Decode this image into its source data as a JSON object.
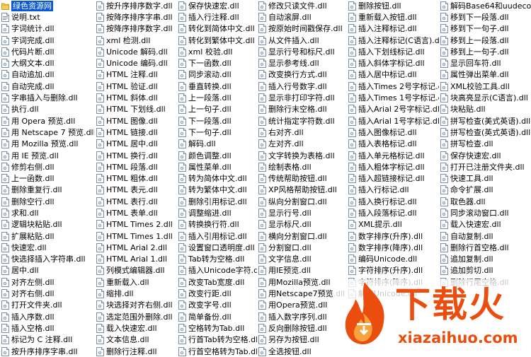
{
  "colors": {
    "selection": "#0a58d6",
    "watermark": "#ea4d0e"
  },
  "icons": {
    "folder": "folder-icon",
    "text_file": "text-file-icon",
    "dll_file": "dll-file-icon"
  },
  "columns": [
    [
      {
        "name": "绿色资源网",
        "icon": "folder",
        "selected": true
      },
      {
        "name": "说明.txt",
        "icon": "txt"
      },
      {
        "name": "字词统计.dll"
      },
      {
        "name": "字词完成.dll"
      },
      {
        "name": "代码片断.dll"
      },
      {
        "name": "大纲文本.dll"
      },
      {
        "name": "自动追加.dll"
      },
      {
        "name": "自动完成.dll"
      },
      {
        "name": "字串插入与删除.dll"
      },
      {
        "name": "执行.dll"
      },
      {
        "name": "用 Opera 预览.dll"
      },
      {
        "name": "用 Netscape 7 预览.dll"
      },
      {
        "name": "用 Mozilla 预览.dll"
      },
      {
        "name": "用 IE 预览.dll"
      },
      {
        "name": "修剪右侧.dll"
      },
      {
        "name": "上一函数.dll"
      },
      {
        "name": "删除重复行.dll"
      },
      {
        "name": "删除空行.dll"
      },
      {
        "name": "求和.dll"
      },
      {
        "name": "逻辑块粘贴.dll"
      },
      {
        "name": "扩展粘贴.dll"
      },
      {
        "name": "快速宏.dll"
      },
      {
        "name": "快选择插入字符串.dll"
      },
      {
        "name": "居中.dll"
      },
      {
        "name": "对齐左侧.dll"
      },
      {
        "name": "对齐右侧.dll"
      },
      {
        "name": "打开文件夹.dll"
      },
      {
        "name": "插入序数.dll"
      },
      {
        "name": "插入空格.dll"
      },
      {
        "name": "标记为 C 注释.dll"
      },
      {
        "name": "按升序排序字串.dll"
      }
    ],
    [
      {
        "name": "按升序排序数字.dll"
      },
      {
        "name": "按降序排序字串.dll"
      },
      {
        "name": "按降序排序数字.dll"
      },
      {
        "name": "xml 检测.dll"
      },
      {
        "name": "Unicode 解码.dll"
      },
      {
        "name": "Unicode 编码.dll"
      },
      {
        "name": "HTML 注释.dll"
      },
      {
        "name": "HTML 验证.dll"
      },
      {
        "name": "HTML 斜体.dll"
      },
      {
        "name": "HTML 下划线.dll"
      },
      {
        "name": "HTML 图像.dll"
      },
      {
        "name": "HTML 链接.dll"
      },
      {
        "name": "HTML 居中.dll"
      },
      {
        "name": "HTML 换行.dll"
      },
      {
        "name": "HTML 段落.dll"
      },
      {
        "name": "HTML 粗体.dll"
      },
      {
        "name": "HTML 表元.dll"
      },
      {
        "name": "HTML 表行.dll"
      },
      {
        "name": "HTML 表单.dll"
      },
      {
        "name": "HTML Times 2.dll"
      },
      {
        "name": "HTML Times 1.dll"
      },
      {
        "name": "HTML Arial 2.dll"
      },
      {
        "name": "HTML Arial 1.dll"
      },
      {
        "name": "列模式编辑器.dll"
      },
      {
        "name": "重新载入.dll"
      },
      {
        "name": "缩排.dll"
      },
      {
        "name": "块选择对齐右侧.dll"
      },
      {
        "name": "选定范围外删除.dll"
      },
      {
        "name": "载入快速宏.dll"
      },
      {
        "name": "文本信息.dll"
      },
      {
        "name": "删除行注释.dll"
      }
    ],
    [
      {
        "name": "保存快速宏.dll"
      },
      {
        "name": "插入行注释.dll"
      },
      {
        "name": "转化到简体中文.dll"
      },
      {
        "name": "转化到繁体中文.dll"
      },
      {
        "name": "xml 校验.dll"
      },
      {
        "name": "下一函数.dll"
      },
      {
        "name": "同步滚动.dll"
      },
      {
        "name": "垂直转换.dll"
      },
      {
        "name": "上一段落.dll"
      },
      {
        "name": "上一句子.dll"
      },
      {
        "name": "下一段落.dll"
      },
      {
        "name": "下一句子.dll"
      },
      {
        "name": "解码.dll"
      },
      {
        "name": "颜色调整.dll"
      },
      {
        "name": "属性菜单.dll"
      },
      {
        "name": "转为简体中文.dll"
      },
      {
        "name": "转为繁体中文.dll"
      },
      {
        "name": "删除引用标记.dll"
      },
      {
        "name": "调整缩进.dll"
      },
      {
        "name": "转换换行符.dll"
      },
      {
        "name": "插入引用标记.dll"
      },
      {
        "name": "设置窗口透明度.dll"
      },
      {
        "name": "Tab转为空格.dll"
      },
      {
        "name": "插入Unicode字符.dll"
      },
      {
        "name": "改变Tab宽度.dll"
      },
      {
        "name": "改变行距.dll"
      },
      {
        "name": "改变字号.dll"
      },
      {
        "name": "简单备份.dll"
      },
      {
        "name": "空格转为Tab.dll"
      },
      {
        "name": "行首Tab转为空格.dll"
      },
      {
        "name": "行首空格转为Tab.dll"
      }
    ],
    [
      {
        "name": "修改只读文件.dll"
      },
      {
        "name": "自动滚屏.dll"
      },
      {
        "name": "按原始时间戳保存.dll"
      },
      {
        "name": "从文件插入.dll"
      },
      {
        "name": "显示行号和标尺.dll"
      },
      {
        "name": "显示参考线.dll"
      },
      {
        "name": "改变换行方式.dll"
      },
      {
        "name": "插入行号数字.dll"
      },
      {
        "name": "显示非打印字符.dll"
      },
      {
        "name": "删除行末空格.dll"
      },
      {
        "name": "统计指定字符数.dll"
      },
      {
        "name": "右对齐.dll"
      },
      {
        "name": "左对齐.dll"
      },
      {
        "name": "文字转换为表格.dll"
      },
      {
        "name": "绘制表格.dll"
      },
      {
        "name": "传统帮助按钮.dll"
      },
      {
        "name": "XP风格帮助按钮.dll"
      },
      {
        "name": "纵向分割窗口.dll"
      },
      {
        "name": "显示行号.dll"
      },
      {
        "name": "显示标尺.dll"
      },
      {
        "name": "横向分割窗口.dll"
      },
      {
        "name": "分割窗口.dll"
      },
      {
        "name": "文字信息.dll"
      },
      {
        "name": "用IE预览.dll"
      },
      {
        "name": "用Mozilla预览.dll"
      },
      {
        "name": "用Netscape7预览.dll"
      },
      {
        "name": "用Opera预览.dll"
      },
      {
        "name": "插入数字序列.dll"
      },
      {
        "name": "反向删除按钮.dll"
      },
      {
        "name": "另存为按钮.dll"
      },
      {
        "name": "全选按钮.dll"
      }
    ],
    [
      {
        "name": "删除按钮.dll"
      },
      {
        "name": "重新载入按钮.dll"
      },
      {
        "name": "插入注释标记.dll"
      },
      {
        "name": "插入注释标记(C语言).dll"
      },
      {
        "name": "插入下划线标记.dll"
      },
      {
        "name": "插入斜体字标记.dll"
      },
      {
        "name": "插入居中标记.dll"
      },
      {
        "name": "插入Times 2号字标记.dll"
      },
      {
        "name": "插入Times 1号字标记.dll"
      },
      {
        "name": "插入Arial 2号字标记.dll"
      },
      {
        "name": "插入Arial 1号字标记.dll"
      },
      {
        "name": "插入图像标记.dll"
      },
      {
        "name": "插入表格标记.dll"
      },
      {
        "name": "插入单元格标记.dll"
      },
      {
        "name": "插入粗体字标记.dll"
      },
      {
        "name": "插入超链接标记.dll"
      },
      {
        "name": "插入行标记.dll"
      },
      {
        "name": "插入换行标记.dll"
      },
      {
        "name": "插入段落标记.dll"
      },
      {
        "name": "XML提示.dll"
      },
      {
        "name": "数字排序(升序).dll"
      },
      {
        "name": "数字排序(降序).dll"
      },
      {
        "name": "编码Unicode.dll"
      },
      {
        "name": "字符排序(升序).dll"
      },
      {
        "name": "字符排序(降序).dll"
      },
      {
        "name": "解码Unicode.dll"
      },
      {
        "name": "",
        "hidden": true
      },
      {
        "name": "",
        "hidden": true
      },
      {
        "name": "",
        "hidden": true
      },
      {
        "name": "",
        "hidden": true
      },
      {
        "name": "",
        "hidden": true
      }
    ],
    [
      {
        "name": "解码Base64和uudecode.dll"
      },
      {
        "name": "移到下一段落.dll"
      },
      {
        "name": "移到下一句子.dll"
      },
      {
        "name": "移到上一段落.dll"
      },
      {
        "name": "移到上一句子.dll"
      },
      {
        "name": "显示回车符.dll"
      },
      {
        "name": "属性弹出菜单.dll"
      },
      {
        "name": "XML校验工具.dll"
      },
      {
        "name": "块高亮显示(C语言).dll"
      },
      {
        "name": "块粘贴.dll"
      },
      {
        "name": "拼写检查(美式英语).dll"
      },
      {
        "name": "拼写检查(英式英语).dll"
      },
      {
        "name": "拼写检查.dll"
      },
      {
        "name": "保存快速宏.dll"
      },
      {
        "name": "打开已注册文件夹.dll"
      },
      {
        "name": "快速工具.dll"
      },
      {
        "name": "命令扩展.dll"
      },
      {
        "name": "取色器.dll"
      },
      {
        "name": "同步滚动窗口.dll"
      },
      {
        "name": "载入快速宏.dll"
      },
      {
        "name": "自动复制.dll"
      },
      {
        "name": "删除行首空格.dll"
      },
      {
        "name": "追加复制.dll"
      },
      {
        "name": "追加剪切.dll"
      },
      {
        "name": "删除行尾空格.dll"
      },
      {
        "name": "",
        "hidden": true
      },
      {
        "name": "",
        "hidden": true
      },
      {
        "name": "",
        "hidden": true
      },
      {
        "name": "",
        "hidden": true
      },
      {
        "name": "",
        "hidden": true
      },
      {
        "name": "",
        "hidden": true
      }
    ]
  ],
  "watermark": {
    "title": "下载火",
    "url": "xiazaihuo.com"
  }
}
